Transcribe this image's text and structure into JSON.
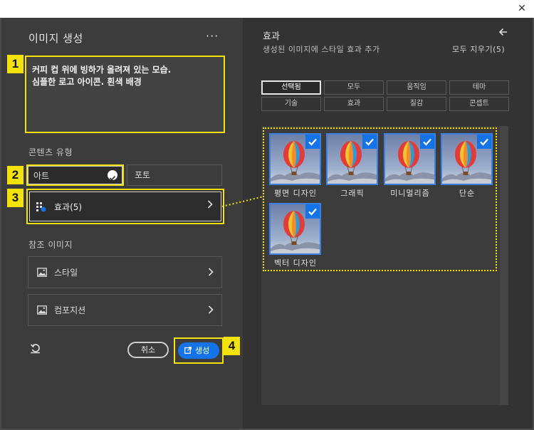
{
  "window": {
    "close_label": "✕"
  },
  "left": {
    "title": "이미지 생성",
    "more_label": "···",
    "prompt": "커피 컵 위에 빙하가 올려져 있는 모습.\n심플한 로고 아이콘. 흰색 배경",
    "content_type_label": "콘텐츠 유형",
    "content_types": [
      {
        "label": "아트",
        "selected": true
      },
      {
        "label": "포토",
        "selected": false
      }
    ],
    "effects_label": "효과(5)",
    "reference_label": "참조 이미지",
    "reference_items": [
      {
        "label": "스타일",
        "icon": "image-icon"
      },
      {
        "label": "컴포지션",
        "icon": "image-icon"
      }
    ],
    "cancel_label": "취소",
    "generate_label": "생성"
  },
  "badges": [
    "1",
    "2",
    "3",
    "4"
  ],
  "right": {
    "title": "효과",
    "subtitle": "생성된 이미지에 스타일 효과 추가",
    "clear_all": "모두 지우기(5)",
    "chips": [
      {
        "label": "선택됨",
        "selected": true
      },
      {
        "label": "모두",
        "selected": false
      },
      {
        "label": "움직임",
        "selected": false
      },
      {
        "label": "테마",
        "selected": false
      },
      {
        "label": "기술",
        "selected": false
      },
      {
        "label": "효과",
        "selected": false
      },
      {
        "label": "질감",
        "selected": false
      },
      {
        "label": "콘셉트",
        "selected": false
      }
    ],
    "effects": [
      {
        "label": "평면 디자인",
        "checked": true
      },
      {
        "label": "그래픽",
        "checked": true
      },
      {
        "label": "미니멀리즘",
        "checked": true
      },
      {
        "label": "단순",
        "checked": true
      },
      {
        "label": "벡터 디자인",
        "checked": true
      }
    ]
  },
  "colors": {
    "accent": "#1473e6",
    "highlight": "#f4e20b"
  }
}
